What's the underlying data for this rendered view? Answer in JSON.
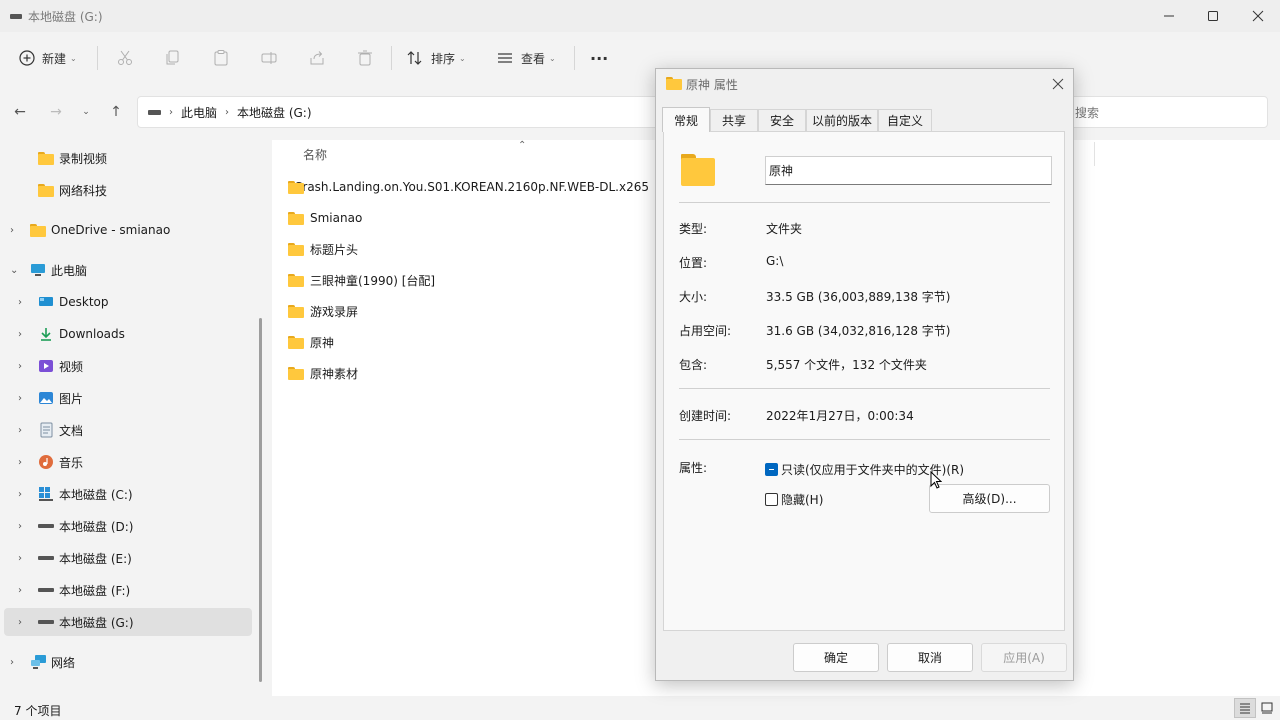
{
  "window": {
    "title": "本地磁盘 (G:)"
  },
  "toolbar": {
    "new_label": "新建",
    "sort_label": "排序",
    "view_label": "查看",
    "more_label": "···"
  },
  "address": {
    "segments": [
      "此电脑",
      "本地磁盘 (G:)"
    ],
    "search_placeholder": "搜索"
  },
  "sidebar": {
    "items": [
      {
        "label": "录制视频",
        "icon": "folder-icon"
      },
      {
        "label": "网络科技",
        "icon": "folder-icon"
      },
      {
        "label": "OneDrive - smianao",
        "icon": "folder-icon"
      },
      {
        "label": "此电脑",
        "icon": "computer-icon"
      },
      {
        "label": "Desktop",
        "icon": "desktop-icon"
      },
      {
        "label": "Downloads",
        "icon": "download-icon"
      },
      {
        "label": "视频",
        "icon": "video-icon"
      },
      {
        "label": "图片",
        "icon": "picture-icon"
      },
      {
        "label": "文档",
        "icon": "document-icon"
      },
      {
        "label": "音乐",
        "icon": "music-icon"
      },
      {
        "label": "本地磁盘 (C:)",
        "icon": "windows-drive-icon"
      },
      {
        "label": "本地磁盘 (D:)",
        "icon": "drive-icon"
      },
      {
        "label": "本地磁盘 (E:)",
        "icon": "drive-icon"
      },
      {
        "label": "本地磁盘 (F:)",
        "icon": "drive-icon"
      },
      {
        "label": "本地磁盘 (G:)",
        "icon": "drive-icon",
        "selected": true
      },
      {
        "label": "网络",
        "icon": "network-icon"
      }
    ]
  },
  "filelist": {
    "column_name": "名称",
    "files": [
      "Crash.Landing.on.You.S01.KOREAN.2160p.NF.WEB-DL.x265.",
      "Smianao",
      "标题片头",
      "三眼神童(1990) [台配]",
      "游戏录屏",
      "原神",
      "原神素材"
    ]
  },
  "status": {
    "item_count": "7 个项目"
  },
  "dialog": {
    "title": "原神 属性",
    "tabs": [
      "常规",
      "共享",
      "安全",
      "以前的版本",
      "自定义"
    ],
    "active_tab": "常规",
    "name_value": "原神",
    "rows": {
      "type": {
        "label": "类型:",
        "value": "文件夹"
      },
      "location": {
        "label": "位置:",
        "value": "G:\\"
      },
      "size": {
        "label": "大小:",
        "value": "33.5 GB (36,003,889,138 字节)"
      },
      "disk_size": {
        "label": "占用空间:",
        "value": "31.6 GB (34,032,816,128 字节)"
      },
      "contains": {
        "label": "包含:",
        "value": "5,557 个文件，132 个文件夹"
      },
      "created": {
        "label": "创建时间:",
        "value": "2022年1月27日，0:00:34"
      }
    },
    "attributes_label": "属性:",
    "readonly_label": "只读(仅应用于文件夹中的文件)(R)",
    "hidden_label": "隐藏(H)",
    "advanced_label": "高级(D)...",
    "ok_label": "确定",
    "cancel_label": "取消",
    "apply_label": "应用(A)"
  },
  "colors": {
    "folder": "#ffc83d",
    "accent": "#0067c0",
    "selection": "#e0e0e0"
  }
}
